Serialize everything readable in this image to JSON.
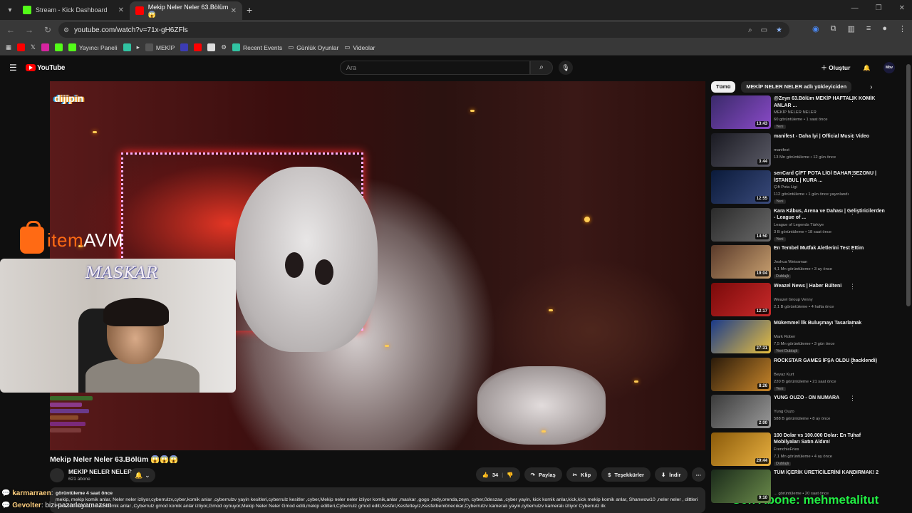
{
  "browser": {
    "tabs": [
      {
        "title": "Stream - Kick Dashboard",
        "favicon_color": "#53fc18"
      },
      {
        "title": "Mekip Neler Neler 63.Bölüm 😱",
        "favicon_color": "#ff0000"
      }
    ],
    "url": "youtube.com/watch?v=71x-gH6ZFls",
    "bookmarks": [
      "Yayıncı Paneli",
      "MEKİP",
      "Recent Events",
      "Günlük Oyunlar",
      "Videolar"
    ]
  },
  "youtube": {
    "logo": "YouTube",
    "search_placeholder": "Ara",
    "create_label": "Oluştur",
    "profile_label": "Mbv"
  },
  "overlay": {
    "watermark": "dijipin",
    "sponsor": "itemAVM",
    "sponsor_part1": "item",
    "sponsor_part2": "AVM",
    "webcam_name": "MASKAR",
    "chat1_user": "karmarraen",
    "chat1_msg": ": ",
    "chat2_user": "Gevolter",
    "chat2_msg": ": bizi pazarlayamazsın",
    "sub_alert": "Son Abone: mehmetalitut"
  },
  "video": {
    "title": "Mekip Neler Neler 63.Bölüm 😱😱😱",
    "channel": "MEKİP NELER NELER",
    "subscribers": "621 abone",
    "likes": "34",
    "actions": [
      "Paylaş",
      "Klip",
      "Teşekkürler",
      "İndir"
    ],
    "views_meta": "görüntüleme  4 saat önce",
    "description": "mekip, mekip komik anlar, Neler neler izliyor,cyberrulzv,cyber,komik anlar ,cyberrulzv yayin kesitleri,cyberrulz kesitler ,cyber,Mekip neler neler izliyor komik,anlar ,maskar ,gogo ,tedy,orenda,zeyn, cyber,0deszaa ,cyber yayin, kick komik anlar,kick,kick mekip komik anlar, Shanwow10 ,neler neler , dittleri Fena feci feifeci,Gmod Komik anlar ,Cyberrulz gmod komik anlar izliyor,Gmod oynuyor,Mekip Neler Neler Gmod editi,mekip editleri,Cyberrulz gmod editi,Kesfet,Kesfetteyiz,Kesfetbeniönecıkar,Cyberrulzv kameralı yayin,cyberrulzv kameralı izliyor Cyberrulz ilk"
  },
  "sidebar": {
    "chips": [
      "Tümü",
      "MEKİP NELER NELER adlı yükleyiciden"
    ],
    "items": [
      {
        "title": "@Zeyn 63.Bölüm MEKİP HAFTALIK KOMİK ANLAR ...",
        "channel": "MEKİP NELER NELER",
        "meta": "60 görüntüleme • 1 saat önce",
        "badge": "Yeni",
        "duration": "13:43",
        "c1": "#3a2a6a",
        "c2": "#8a4ac8"
      },
      {
        "title": "manifest - Daha İyi | Official Music Video",
        "channel": "manifest",
        "meta": "13 Mn görüntüleme • 12 gün önce",
        "badge": "",
        "duration": "3:44",
        "c1": "#1a1a22",
        "c2": "#5a5a66"
      },
      {
        "title": "senCard ÇİFT POTA LİGİ BAHAR SEZONU | İSTANBUL | KURA ...",
        "channel": "Çift Pota Ligi",
        "meta": "112 görüntüleme • 1 gün önce yayınlandı",
        "badge": "Yeni",
        "duration": "12:55",
        "c1": "#0a1a3a",
        "c2": "#3a4a7a"
      },
      {
        "title": "Kara Kâbus, Arena ve Dahası | Geliştiricilerden - League of ...",
        "channel": "League of Legends Türkiye",
        "meta": "3 B görüntüleme • 18 saat önce",
        "badge": "Yeni",
        "duration": "14:50",
        "c1": "#2a2a2a",
        "c2": "#6a6a6a"
      },
      {
        "title": "En Tembel Mutfak Aletlerini Test Ettim",
        "channel": "Joshua Weissman",
        "meta": "4,1 Mn görüntüleme • 3 ay önce",
        "badge": "Dublajlı",
        "duration": "19:04",
        "c1": "#5a3a2a",
        "c2": "#c8a070"
      },
      {
        "title": "Weazel News | Haber Bülteni",
        "channel": "Weazel Group Venny",
        "meta": "2,1 B görüntüleme • 4 hafta önce",
        "badge": "",
        "duration": "12:17",
        "c1": "#7a0a0a",
        "c2": "#c82a2a"
      },
      {
        "title": "Mükemmel İlk Buluşmayı Tasarlamak",
        "channel": "Mark Rober",
        "meta": "7,5 Mn görüntüleme • 3 gün önce",
        "badge": "Yeni  Dublajlı",
        "duration": "27:31",
        "c1": "#1a3a8a",
        "c2": "#e8c040"
      },
      {
        "title": "ROCKSTAR GAMES İFŞA OLDU (hacklendi)",
        "channel": "Beyaz Kurt",
        "meta": "220 B görüntüleme • 21 saat önce",
        "badge": "Yeni",
        "duration": "8:26",
        "c1": "#2a1a0a",
        "c2": "#c8862a"
      },
      {
        "title": "YUNG OUZO - ON NUMARA",
        "channel": "Yung Ouzo",
        "meta": "588 B görüntüleme • 8 ay önce",
        "badge": "",
        "duration": "2:00",
        "c1": "#3a3a3a",
        "c2": "#9a9a9a"
      },
      {
        "title": "100 Dolar vs 100.000 Dolar: En Tuhaf Mobilyaları Satın Aldım!",
        "channel": "FrenchieFries",
        "meta": "7,1 Mn görüntüleme • 4 ay önce",
        "badge": "Dublajlı",
        "duration": "29:44",
        "c1": "#8a5a0a",
        "c2": "#e8b040"
      },
      {
        "title": "TÜM İÇERİK ÜRETİCİLERİNİ KANDIRMAK! 2",
        "channel": "",
        "meta": "... görüntüleme • 20 saat önce",
        "badge": "",
        "duration": "9:10",
        "c1": "#1a2a1a",
        "c2": "#6a8a4a"
      }
    ]
  }
}
